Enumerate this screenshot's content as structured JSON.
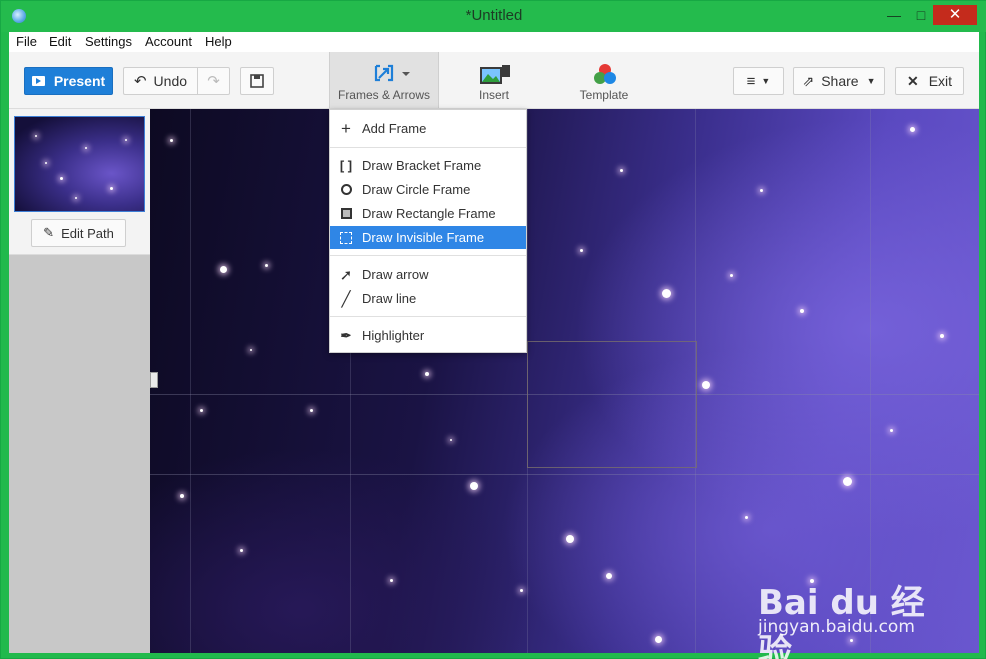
{
  "window": {
    "title": "*Untitled",
    "controls": {
      "minimize": "—",
      "maximize": "□",
      "close": "✕"
    }
  },
  "menubar": {
    "items": [
      "File",
      "Edit",
      "Settings",
      "Account",
      "Help"
    ]
  },
  "toolbar": {
    "present_label": "Present",
    "undo_label": "Undo",
    "share_label": "Share",
    "exit_label": "Exit",
    "tabs": [
      {
        "label": "Frames & Arrows",
        "icon": "frames-arrows-icon"
      },
      {
        "label": "Insert",
        "icon": "insert-image-icon"
      },
      {
        "label": "Template",
        "icon": "template-icon"
      }
    ]
  },
  "sidebar": {
    "edit_path_label": "Edit Path"
  },
  "dropdown": {
    "items": [
      {
        "label": "Add Frame",
        "icon": "plus-icon"
      },
      {
        "label": "Draw Bracket Frame",
        "icon": "bracket-frame-icon"
      },
      {
        "label": "Draw Circle Frame",
        "icon": "circle-frame-icon"
      },
      {
        "label": "Draw Rectangle Frame",
        "icon": "rectangle-frame-icon"
      },
      {
        "label": "Draw Invisible Frame",
        "icon": "invisible-frame-icon",
        "selected": true
      },
      {
        "label": "Draw arrow",
        "icon": "arrow-icon"
      },
      {
        "label": "Draw line",
        "icon": "line-icon"
      },
      {
        "label": "Highlighter",
        "icon": "highlighter-icon"
      }
    ]
  },
  "watermark": {
    "logo": "Bai du 经验",
    "url": "jingyan.baidu.com"
  },
  "colors": {
    "accent": "#1e7fd8",
    "selected": "#2f86e6",
    "chrome": "#24bb4d"
  }
}
